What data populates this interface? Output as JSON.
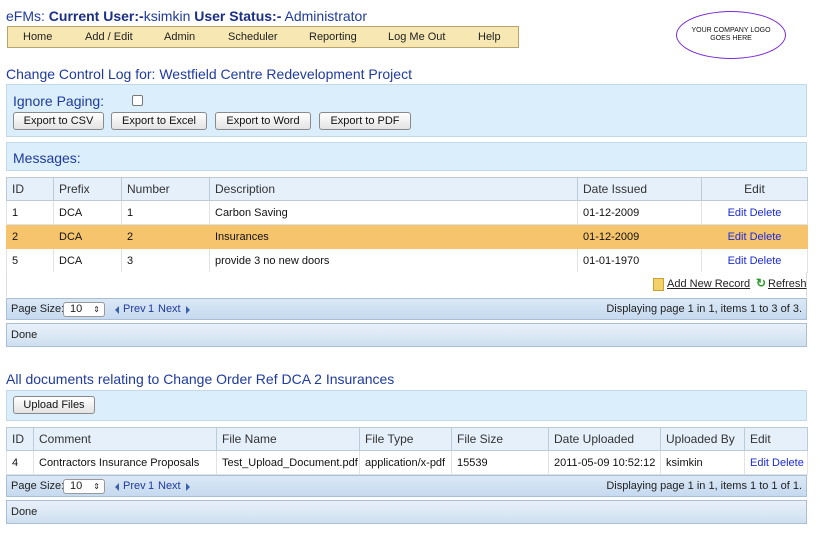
{
  "header": {
    "app": "eFMs:",
    "user_label": "Current User:-",
    "user": "ksimkin",
    "status_label": "User Status:-",
    "status": "Administrator"
  },
  "menu": [
    "Home",
    "Add / Edit",
    "Admin",
    "Scheduler",
    "Reporting",
    "Log Me Out",
    "Help"
  ],
  "logo_text": "YOUR COMPANY LOGO GOES HERE",
  "page_title": "Change Control Log for: Westfield Centre Redevelopment Project",
  "export": {
    "ignore_paging_label": "Ignore Paging:",
    "buttons": [
      "Export to CSV",
      "Export to Excel",
      "Export to Word",
      "Export to PDF"
    ]
  },
  "messages_label": "Messages:",
  "change_grid": {
    "headers": [
      "ID",
      "Prefix",
      "Number",
      "Description",
      "Date Issued",
      "Edit"
    ],
    "rows": [
      {
        "id": "1",
        "prefix": "DCA",
        "number": "1",
        "description": "Carbon Saving",
        "date": "01-12-2009"
      },
      {
        "id": "2",
        "prefix": "DCA",
        "number": "2",
        "description": "Insurances",
        "date": "01-12-2009"
      },
      {
        "id": "5",
        "prefix": "DCA",
        "number": "3",
        "description": "provide 3 no new doors",
        "date": "01-01-1970"
      }
    ],
    "edit_label": "Edit",
    "delete_label": "Delete",
    "add_new_label": "Add New Record",
    "refresh_label": "Refresh",
    "page_size_label": "Page Size:",
    "page_size": "10",
    "prev_label": "Prev",
    "page_num": "1",
    "next_label": "Next",
    "paging_info": "Displaying page 1 in 1, items 1 to 3 of 3.",
    "status": "Done"
  },
  "docs_title": "All documents relating to Change Order Ref DCA 2 Insurances",
  "upload_label": "Upload Files",
  "docs_grid": {
    "headers": [
      "ID",
      "Comment",
      "File Name",
      "File Type",
      "File Size",
      "Date Uploaded",
      "Uploaded By",
      "Edit"
    ],
    "rows": [
      {
        "id": "4",
        "comment": "Contractors Insurance Proposals",
        "file_name": "Test_Upload_Document.pdf",
        "file_type": "application/x-pdf",
        "file_size": "15539",
        "date": "2011-05-09 10:52:12",
        "by": "ksimkin"
      }
    ],
    "edit_label": "Edit",
    "delete_label": "Delete",
    "page_size_label": "Page Size:",
    "page_size": "10",
    "prev_label": "Prev",
    "page_num": "1",
    "next_label": "Next",
    "paging_info": "Displaying page 1 in 1, items 1 to 1 of 1.",
    "status": "Done"
  }
}
